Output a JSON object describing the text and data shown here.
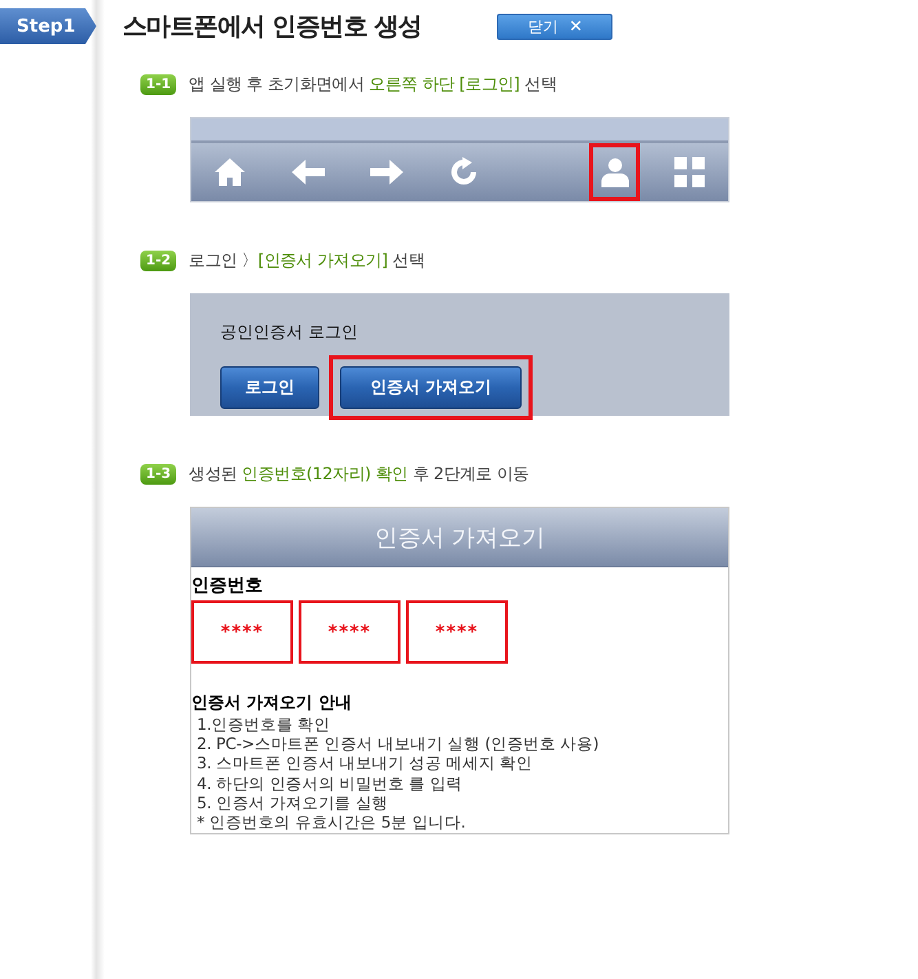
{
  "step_tab": {
    "label": "Step1"
  },
  "title": "스마트폰에서 인증번호 생성",
  "close_button": {
    "label": "닫기",
    "icon": "✕"
  },
  "steps": [
    {
      "badge": "1-1",
      "instruction": [
        {
          "text": "앱 실행 후 초기화면에서 ",
          "highlight": false
        },
        {
          "text": "오른쪽 하단 [로그인]",
          "highlight": true
        },
        {
          "text": " 선택",
          "highlight": false
        }
      ],
      "screen": {
        "kind": "toolbar",
        "icons": [
          {
            "kind": "home",
            "highlighted": false
          },
          {
            "kind": "back",
            "highlighted": false
          },
          {
            "kind": "forward",
            "highlighted": false
          },
          {
            "kind": "refresh",
            "highlighted": false
          },
          {
            "kind": "user",
            "highlighted": true
          },
          {
            "kind": "grid",
            "highlighted": false
          }
        ]
      }
    },
    {
      "badge": "1-2",
      "instruction": [
        {
          "text": "로그인 〉",
          "highlight": false
        },
        {
          "text": "[인증서 가져오기]",
          "highlight": true
        },
        {
          "text": " 선택",
          "highlight": false
        }
      ],
      "screen": {
        "kind": "login",
        "heading": "공인인증서 로그인",
        "buttons": [
          {
            "label": "로그인",
            "highlighted": false
          },
          {
            "label": "인증서 가져오기",
            "highlighted": true
          }
        ]
      }
    },
    {
      "badge": "1-3",
      "instruction": [
        {
          "text": "생성된 ",
          "highlight": false
        },
        {
          "text": "인증번호(12자리) 확인",
          "highlight": true
        },
        {
          "text": " 후 2단계로 이동",
          "highlight": false
        }
      ],
      "screen": {
        "kind": "certificate",
        "header": "인증서 가져오기",
        "code_label": "인증번호",
        "codes": [
          {
            "value": "****",
            "highlighted": true
          },
          {
            "value": "****",
            "highlighted": true
          },
          {
            "value": "****",
            "highlighted": true
          }
        ],
        "guide_title": "인증서 가져오기 안내",
        "guide_lines": [
          "1.인증번호를 확인",
          "2. PC->스마트폰 인증서 내보내기 실행 (인증번호  사용)",
          "3. 스마트폰 인증서 내보내기 성공 메세지 확인",
          "4. 하단의 인증서의 비밀번호 를 입력",
          "5. 인증서 가져오기를 실행",
          "* 인증번호의 유효시간은 5분 입니다."
        ]
      }
    }
  ]
}
